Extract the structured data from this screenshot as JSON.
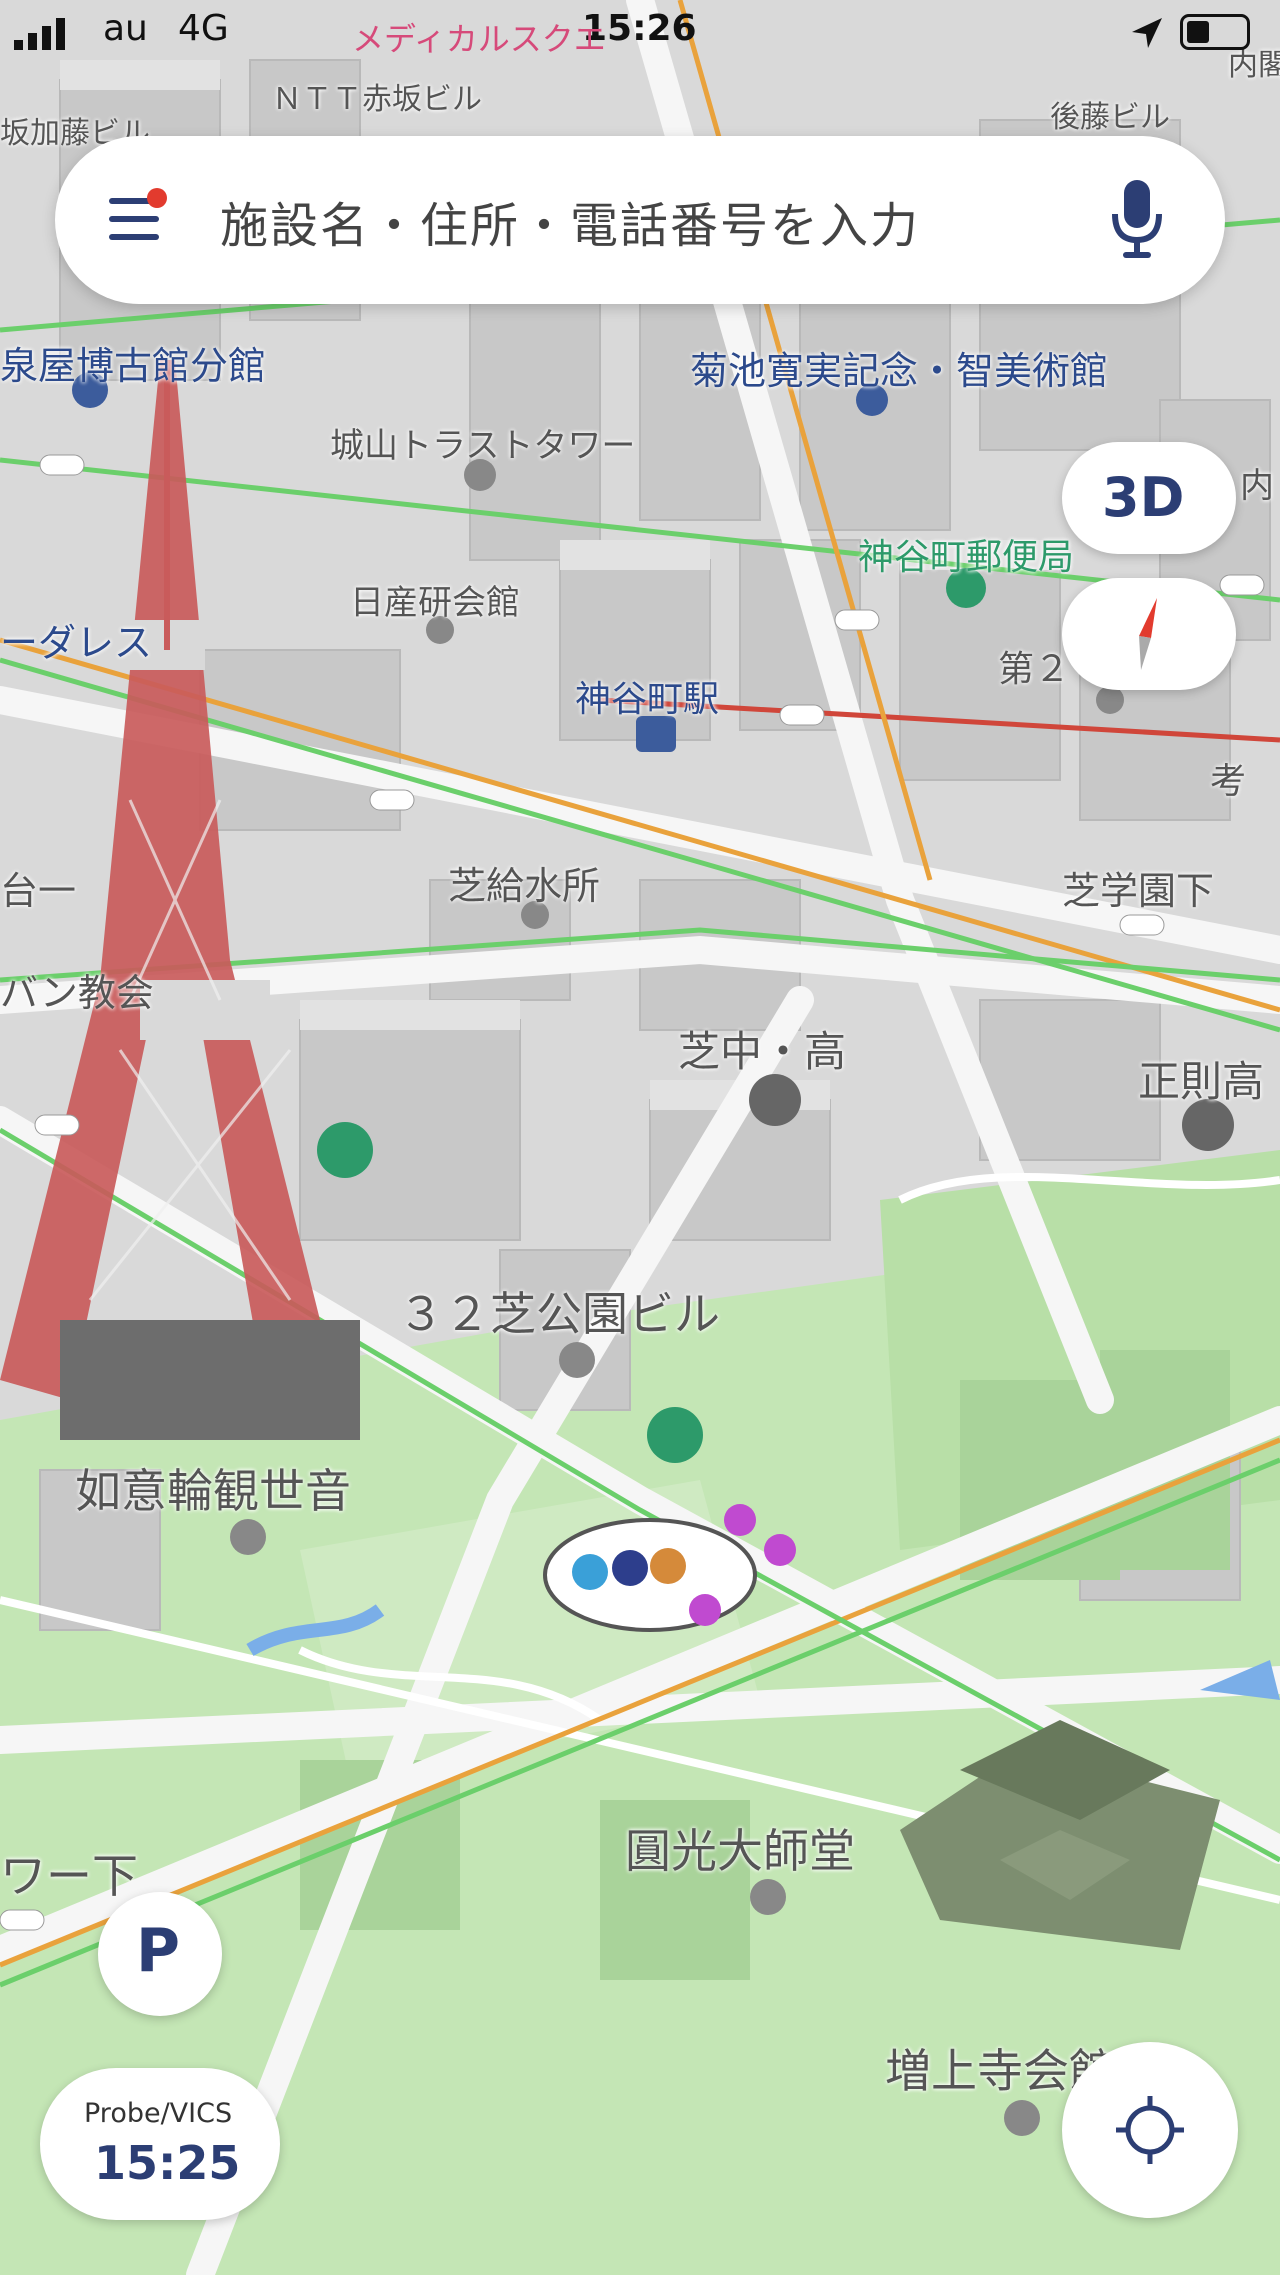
{
  "status_bar": {
    "carrier": "au",
    "network": "4G",
    "time": "15:26",
    "top_label_1": "メディカルスクエ",
    "top_label_2": "ＮＴＴ赤坂ビル",
    "top_label_3": "内閣",
    "top_label_4": "後藤ビル",
    "top_label_5": "坂加藤ビル"
  },
  "search": {
    "placeholder": "施設名・住所・電話番号を入力",
    "menu_icon": "hamburger-icon",
    "has_notification_dot": true,
    "mic_icon": "microphone-icon"
  },
  "controls": {
    "view_mode": "3D",
    "compass_icon": "compass-icon",
    "parking_label": "P",
    "traffic_source": "Probe/VICS",
    "traffic_time": "15:25",
    "locate_icon": "locate-icon"
  },
  "map_labels": {
    "l1": "泉屋博古館分館",
    "l2": "菊池寛実記念・智美術館",
    "l3": "城山トラストタワー",
    "l4": "内",
    "l5": "神谷町郵便局",
    "l6": "日産研会館",
    "l7": "ーダレス",
    "l8": "神谷町駅",
    "l9": "第２",
    "l10": "考",
    "l11": "芝給水所",
    "l12": "芝学園下",
    "l13": "台一",
    "l14": "バン教会",
    "l15": "芝中・高",
    "l16": "正則高",
    "l17": "３２芝公園ビル",
    "l18": "如意輪観世音",
    "l19": "圓光大師堂",
    "l20": "ワー下",
    "l21": "増上寺会館"
  },
  "colors": {
    "accent_navy": "#2c3e74",
    "compass_red": "#e23b2e",
    "park_green": "#bfe3b0",
    "building_gray": "#c9c9c9",
    "road_white": "#f6f6f6",
    "route_green": "#6bcf6b",
    "route_orange": "#e9a23c",
    "route_red": "#d0463a",
    "tower_red": "#c95b5b"
  }
}
